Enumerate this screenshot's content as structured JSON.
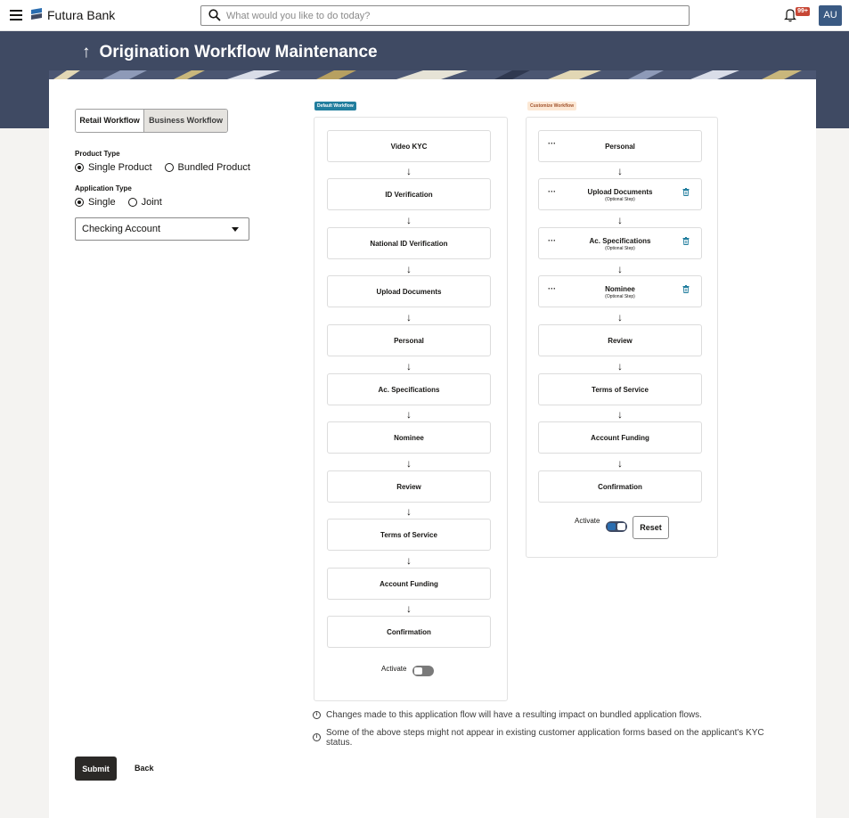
{
  "topbar": {
    "brand": "Futura Bank",
    "search_placeholder": "What would you like to do today?",
    "notification_count": "99+",
    "avatar_initials": "AU"
  },
  "page": {
    "title": "Origination Workflow Maintenance",
    "back_arrow": "↑"
  },
  "tabs": [
    {
      "label": "Retail Workflow",
      "selected": true
    },
    {
      "label": "Business Workflow",
      "selected": false
    }
  ],
  "product_type": {
    "label": "Product Type",
    "options": [
      {
        "label": "Single Product",
        "selected": true
      },
      {
        "label": "Bundled Product",
        "selected": false
      }
    ]
  },
  "application_type": {
    "label": "Application Type",
    "options": [
      {
        "label": "Single",
        "selected": true
      },
      {
        "label": "Joint",
        "selected": false
      }
    ]
  },
  "account_select": {
    "value": "Checking Account"
  },
  "default_workflow": {
    "tag": "Default Workflow",
    "steps": [
      "Video KYC",
      "ID Verification",
      "National ID Verification",
      "Upload Documents",
      "Personal",
      "Ac. Specifications",
      "Nominee",
      "Review",
      "Terms of Service",
      "Account Funding",
      "Confirmation"
    ],
    "activate_label": "Activate",
    "activate_on": false
  },
  "customize_workflow": {
    "tag": "Customize Workflow",
    "steps": [
      {
        "label": "Personal",
        "sub": "",
        "draggable": true,
        "deletable": false
      },
      {
        "label": "Upload Documents",
        "sub": "(Optional Step)",
        "draggable": true,
        "deletable": true
      },
      {
        "label": "Ac. Specifications",
        "sub": "(Optional Step)",
        "draggable": true,
        "deletable": true
      },
      {
        "label": "Nominee",
        "sub": "(Optional Step)",
        "draggable": true,
        "deletable": true
      },
      {
        "label": "Review",
        "sub": "",
        "draggable": false,
        "deletable": false
      },
      {
        "label": "Terms of Service",
        "sub": "",
        "draggable": false,
        "deletable": false
      },
      {
        "label": "Account Funding",
        "sub": "",
        "draggable": false,
        "deletable": false
      },
      {
        "label": "Confirmation",
        "sub": "",
        "draggable": false,
        "deletable": false
      }
    ],
    "activate_label": "Activate",
    "activate_on": true,
    "reset_label": "Reset"
  },
  "step_arrow": "↓",
  "drag_glyph": "···",
  "notes": [
    "Changes made to this application flow will have a resulting impact on bundled application flows.",
    "Some of the above steps might not appear in existing customer application forms based on the applicant's KYC status."
  ],
  "note_icon": "i",
  "footer": {
    "submit_label": "Submit",
    "back_label": "Back"
  },
  "colors": {
    "header": "#3f4a63",
    "primary_button": "#2b2927",
    "default_tag": "#227e9e",
    "custom_tag_bg": "#fce8d5",
    "badge": "#c74634",
    "avatar": "#3a5a83"
  }
}
